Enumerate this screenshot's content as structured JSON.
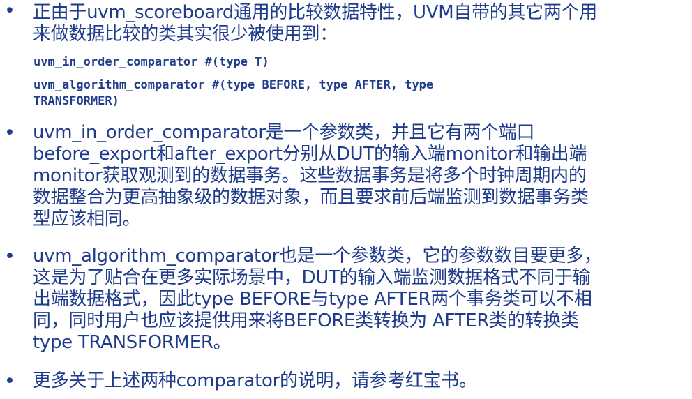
{
  "bullets": [
    {
      "lines": [
        "正由于uvm_scoreboard通用的比较数据特性，UVM自带的其它两个用",
        "来做数据比较的类其实很少被使用到："
      ]
    },
    {
      "lines": [
        "uvm_in_order_comparator是一个参数类，并且它有两个端口",
        "before_export和after_export分别从DUT的输入端monitor和输出端",
        "monitor获取观测到的数据事务。这些数据事务是将多个时钟周期内的",
        "数据整合为更高抽象级的数据对象，而且要求前后端监测到数据事务类",
        "型应该相同。"
      ]
    },
    {
      "lines": [
        "uvm_algorithm_comparator也是一个参数类，它的参数数目要更多，",
        "这是为了贴合在更多实际场景中，DUT的输入端监测数据格式不同于输",
        "出端数据格式，因此type BEFORE与type AFTER两个事务类可以不相",
        "同，同时用户也应该提供用来将BEFORE类转换为 AFTER类的转换类",
        "type TRANSFORMER。"
      ]
    },
    {
      "lines": [
        "更多关于上述两种comparator的说明，请参考红宝书。"
      ]
    }
  ],
  "code": [
    {
      "lines": [
        "uvm_in_order_comparator #(type T)"
      ]
    },
    {
      "lines": [
        "uvm_algorithm_comparator #(type BEFORE, type AFTER, type",
        "TRANSFORMER)"
      ]
    }
  ],
  "bullet_symbol": "•",
  "colors": {
    "text": "#1f3b8c",
    "background": "#ffffff"
  }
}
